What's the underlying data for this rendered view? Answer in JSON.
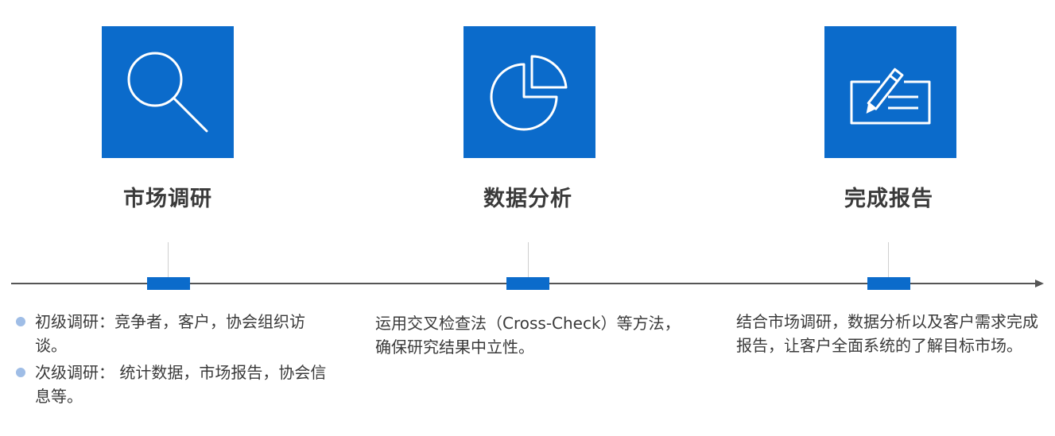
{
  "steps": [
    {
      "title": "市场调研",
      "icon": "magnifier-icon"
    },
    {
      "title": "数据分析",
      "icon": "pie-chart-icon"
    },
    {
      "title": "完成报告",
      "icon": "pen-document-icon"
    }
  ],
  "descriptions": {
    "step1": [
      "初级调研：竞争者，客户，协会组织访谈。",
      "次级调研： 统计数据，市场报告，协会信息等。"
    ],
    "step2": "运用交叉检查法（Cross-Check）等方法，确保研究结果中立性。",
    "step3": "结合市场调研，数据分析以及客户需求完成报告，让客户全面系统的了解目标市场。"
  },
  "colors": {
    "accent": "#0b6bcb",
    "bullet": "#9fbde6",
    "axis": "#555555",
    "text": "#3a3a3a"
  }
}
